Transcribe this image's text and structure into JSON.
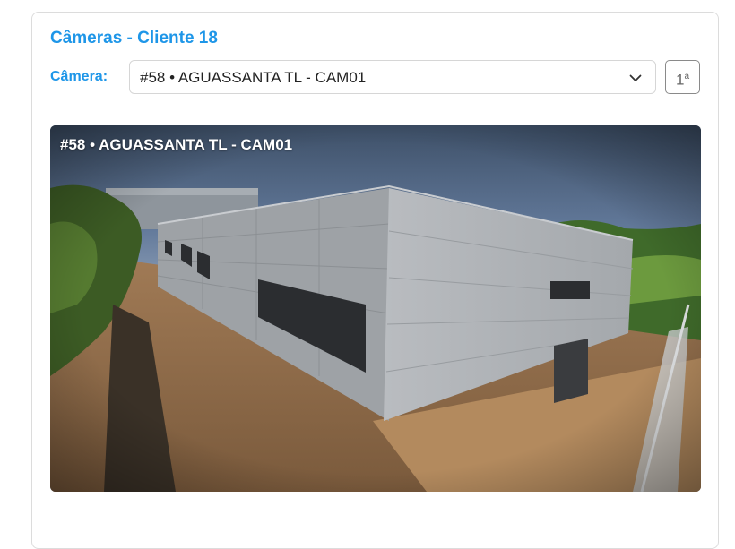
{
  "header": {
    "title": "Câmeras - Cliente 18",
    "camera_label": "Câmera:"
  },
  "camera_select": {
    "selected": "#58 • AGUASSANTA TL - CAM01"
  },
  "page_button": {
    "number": "1",
    "suffix": "a"
  },
  "feed": {
    "caption": "#58 • AGUASSANTA TL - CAM01"
  },
  "colors": {
    "accent": "#1e96e8",
    "border": "#dcdcdc"
  }
}
